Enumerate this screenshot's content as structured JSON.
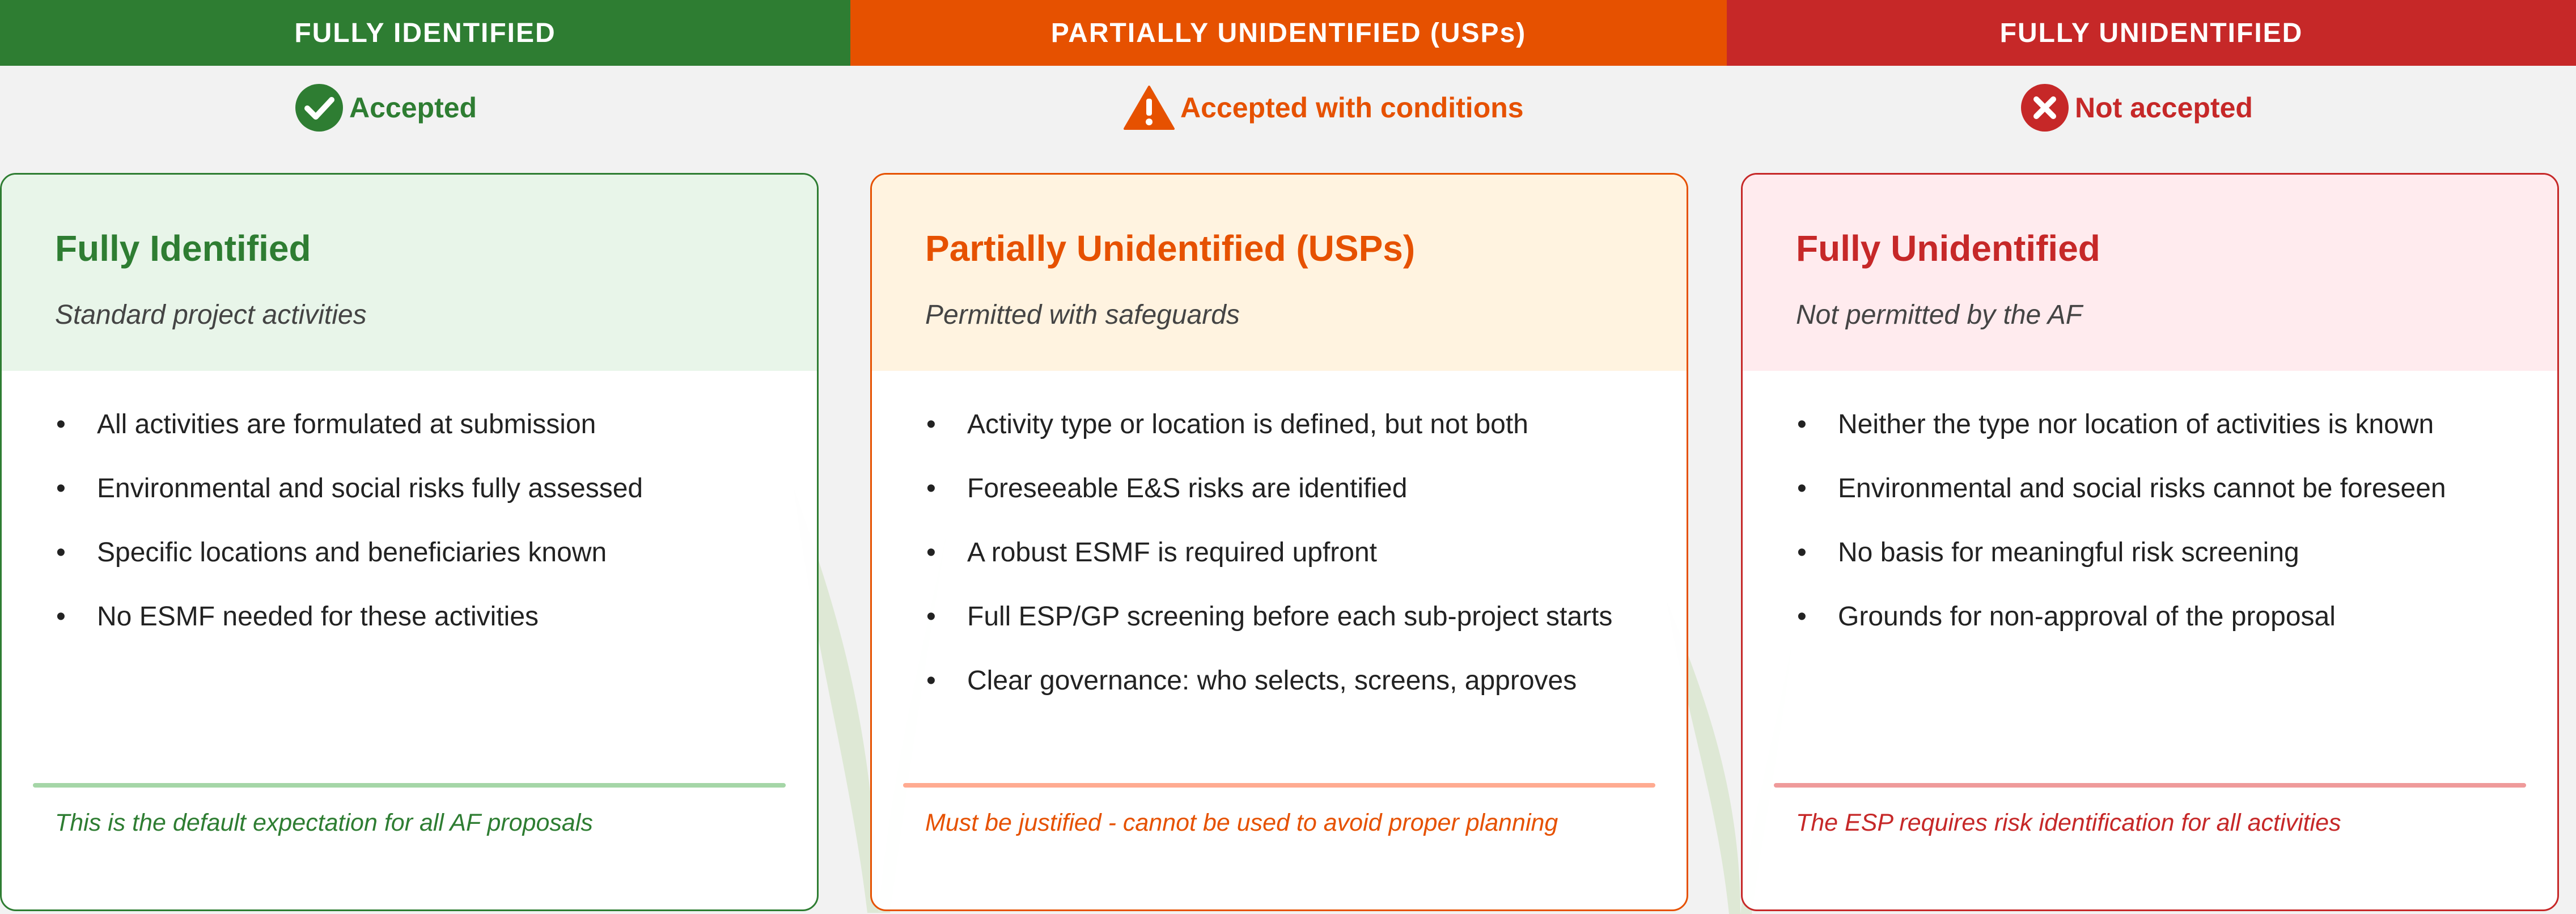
{
  "headers": {
    "green": "FULLY IDENTIFIED",
    "orange": "PARTIALLY UNIDENTIFIED (USPs)",
    "red": "FULLY UNIDENTIFIED"
  },
  "statuses": {
    "green": {
      "label": "Accepted",
      "icon": "check-circle-icon"
    },
    "orange": {
      "label": "Accepted with conditions",
      "icon": "warning-triangle-icon"
    },
    "red": {
      "label": "Not accepted",
      "icon": "x-circle-icon"
    }
  },
  "cards": {
    "green": {
      "title": "Fully Identified",
      "subtitle": "Standard project activities",
      "items": [
        "All activities are formulated at submission",
        "Environmental and social risks fully assessed",
        "Specific locations and beneficiaries known",
        "No ESMF needed for these activities"
      ],
      "footer": "This is the default expectation for all AF proposals"
    },
    "orange": {
      "title": "Partially Unidentified (USPs)",
      "subtitle": "Permitted with safeguards",
      "items": [
        "Activity type or location is defined, but not both",
        "Foreseeable E&S risks are identified",
        "A robust ESMF is required upfront",
        "Full ESP/GP screening before each sub-project starts",
        "Clear governance: who selects, screens, approves"
      ],
      "footer": "Must be justified - cannot be used to avoid proper planning"
    },
    "red": {
      "title": "Fully Unidentified",
      "subtitle": "Not permitted by the AF",
      "items": [
        "Neither the type nor location of activities is known",
        "Environmental and social risks cannot be foreseen",
        "No basis for meaningful risk screening",
        "Grounds for non-approval of the proposal"
      ],
      "footer": "The ESP requires risk identification for all activities"
    }
  },
  "colors": {
    "green": "#2e7d32",
    "orange": "#e65100",
    "red": "#c62828"
  }
}
